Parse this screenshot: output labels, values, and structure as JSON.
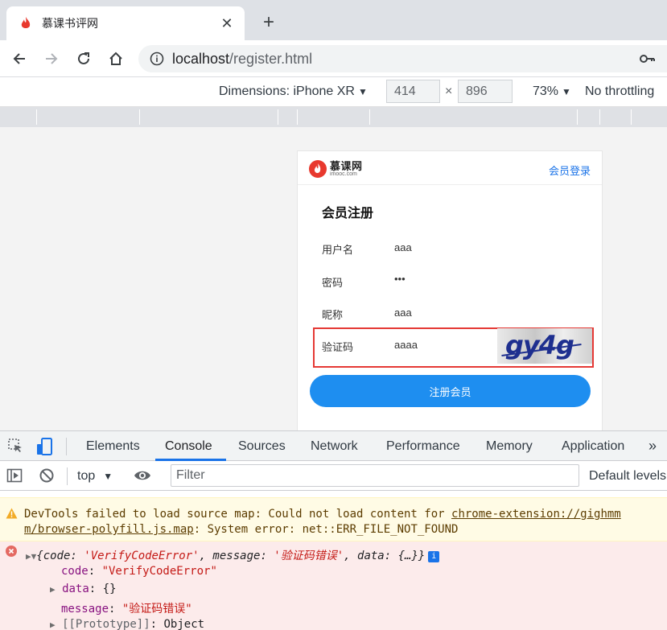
{
  "browser": {
    "tab_title": "慕课书评网",
    "url_host": "localhost",
    "url_path": "/register.html"
  },
  "device_toolbar": {
    "dimensions_label": "Dimensions: iPhone XR",
    "width": "414",
    "height": "896",
    "times": "×",
    "zoom": "73%",
    "throttling": "No throttling"
  },
  "page": {
    "logo_cn": "慕课网",
    "logo_en": "imooc.com",
    "login_link": "会员登录",
    "form_title": "会员注册",
    "fields": [
      {
        "label": "用户名",
        "value": "aaa"
      },
      {
        "label": "密码",
        "value": "•••"
      },
      {
        "label": "昵称",
        "value": "aaa"
      },
      {
        "label": "验证码",
        "value": "aaaa"
      }
    ],
    "captcha_text": "gy4g",
    "submit_label": "注册会员"
  },
  "devtools": {
    "tabs": [
      "Elements",
      "Console",
      "Sources",
      "Network",
      "Performance",
      "Memory",
      "Application"
    ],
    "active_tab": "Console",
    "context": "top",
    "filter_placeholder": "Filter",
    "levels": "Default levels"
  },
  "console": {
    "warning_line1_text": "DevTools failed to load source map: Could not load content for ",
    "warning_line1_link": "chrome-extension://gighmm",
    "warning_line2_link": "m/browser-polyfill.js.map",
    "warning_line2_text": ": System error: net::ERR_FILE_NOT_FOUND",
    "error_summary_open": "{",
    "error_summary_code_key": "code",
    "error_summary_code_val": "'VerifyCodeError'",
    "error_summary_message_key": "message",
    "error_summary_message_val": "'验证码错误'",
    "error_summary_data_key": "data",
    "error_summary_data_val": "{…}}",
    "props": [
      {
        "key": "code",
        "value": "\"VerifyCodeError\""
      },
      {
        "key": "data",
        "value": "{}"
      },
      {
        "key": "message",
        "value": "\"验证码错误\""
      },
      {
        "key": "[[Prototype]]",
        "value": "Object"
      }
    ]
  },
  "colors": {
    "accent": "#1a73e8",
    "submit_button": "#1e8ef0",
    "highlight_border": "#e53935",
    "error_bg": "#fcebeb",
    "warning_bg": "#fffbe5"
  }
}
